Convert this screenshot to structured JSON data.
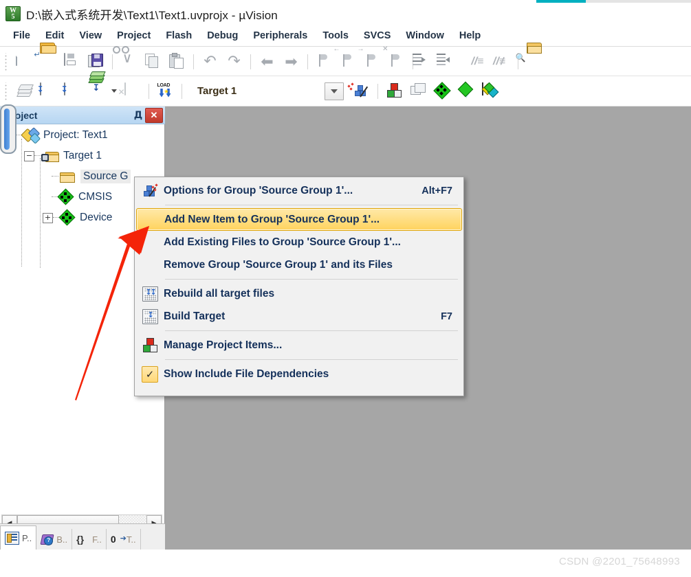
{
  "titlebar": {
    "title": "D:\\嵌入式系统开发\\Text1\\Text1.uvprojx - µVision",
    "app_icon": "keil-uvision-icon",
    "icon_text_top": "W",
    "icon_text_bottom": "5"
  },
  "menubar": {
    "items": [
      {
        "label": "File"
      },
      {
        "label": "Edit"
      },
      {
        "label": "View"
      },
      {
        "label": "Project"
      },
      {
        "label": "Flash"
      },
      {
        "label": "Debug"
      },
      {
        "label": "Peripherals"
      },
      {
        "label": "Tools"
      },
      {
        "label": "SVCS"
      },
      {
        "label": "Window"
      },
      {
        "label": "Help"
      }
    ]
  },
  "toolbar_file": {
    "buttons": [
      {
        "name": "new-file-button",
        "icon": "new-file-icon",
        "tooltip": "New"
      },
      {
        "name": "open-file-button",
        "icon": "open-folder-icon",
        "tooltip": "Open"
      },
      {
        "name": "save-button",
        "icon": "save-disk-icon",
        "tooltip": "Save"
      },
      {
        "name": "save-all-button",
        "icon": "save-all-icon",
        "tooltip": "Save All"
      },
      {
        "name": "cut-button",
        "icon": "scissors-icon",
        "tooltip": "Cut"
      },
      {
        "name": "copy-button",
        "icon": "copy-pages-icon",
        "tooltip": "Copy"
      },
      {
        "name": "paste-button",
        "icon": "clipboard-paste-icon",
        "tooltip": "Paste"
      },
      {
        "name": "undo-button",
        "icon": "undo-arrow-icon",
        "tooltip": "Undo"
      },
      {
        "name": "redo-button",
        "icon": "redo-arrow-icon",
        "tooltip": "Redo"
      },
      {
        "name": "navigate-back-button",
        "icon": "arrow-left-icon",
        "tooltip": "Back"
      },
      {
        "name": "navigate-forward-button",
        "icon": "arrow-right-icon",
        "tooltip": "Forward"
      },
      {
        "name": "insert-bookmark-button",
        "icon": "bookmark-flag-icon",
        "tooltip": "Insert/Remove Bookmark"
      },
      {
        "name": "prev-bookmark-button",
        "icon": "bookmark-prev-icon",
        "tooltip": "Previous Bookmark"
      },
      {
        "name": "next-bookmark-button",
        "icon": "bookmark-next-icon",
        "tooltip": "Next Bookmark"
      },
      {
        "name": "clear-bookmarks-button",
        "icon": "bookmark-clear-icon",
        "tooltip": "Clear All Bookmarks"
      },
      {
        "name": "indent-button",
        "icon": "indent-right-icon",
        "tooltip": "Indent"
      },
      {
        "name": "outdent-button",
        "icon": "indent-left-icon",
        "tooltip": "Outdent"
      },
      {
        "name": "comment-button",
        "icon": "comment-lines-icon",
        "tooltip": "Comment"
      },
      {
        "name": "uncomment-button",
        "icon": "uncomment-lines-icon",
        "tooltip": "Uncomment"
      },
      {
        "name": "find-in-files-button",
        "icon": "find-in-files-icon",
        "tooltip": "Find in Files"
      }
    ]
  },
  "toolbar_build": {
    "buttons": [
      {
        "name": "translate-button",
        "icon": "translate-layers-icon",
        "tooltip": "Translate"
      },
      {
        "name": "build-button",
        "icon": "build-target-icon",
        "tooltip": "Build"
      },
      {
        "name": "rebuild-button",
        "icon": "rebuild-all-icon",
        "tooltip": "Rebuild"
      },
      {
        "name": "batch-build-button",
        "icon": "batch-build-icon",
        "tooltip": "Batch Build"
      },
      {
        "name": "batch-build-dropdown",
        "icon": "chevron-down-icon",
        "tooltip": "Batch Build Options"
      },
      {
        "name": "stop-build-button",
        "icon": "stop-build-icon",
        "tooltip": "Stop Build"
      },
      {
        "name": "download-button",
        "icon": "load-download-icon",
        "tooltip": "Download"
      },
      {
        "name": "target-options-button",
        "icon": "magic-wand-icon",
        "tooltip": "Options for Target"
      },
      {
        "name": "manage-project-items-button",
        "icon": "manage-items-cubes-icon",
        "tooltip": "Manage Project Items"
      },
      {
        "name": "manage-windows-button",
        "icon": "windows-stack-icon",
        "tooltip": "Manage Windows"
      },
      {
        "name": "pack-installer-button",
        "icon": "green-diamond-icon",
        "tooltip": "Pack Installer"
      },
      {
        "name": "manage-run-time-button",
        "icon": "run-time-env-icon",
        "tooltip": "Manage Run-Time Environment"
      },
      {
        "name": "select-software-packs-button",
        "icon": "software-packs-icon",
        "tooltip": "Select Software Packs"
      }
    ],
    "target_value": "Target 1",
    "target_dropdown_icon": "chevron-down-icon"
  },
  "project_panel": {
    "title": "Project",
    "pin_icon": "pin-icon",
    "pin_glyph": "Д",
    "close_icon": "close-icon",
    "close_glyph": "✕",
    "tree": [
      {
        "label": "Project: Text1",
        "icon": "project-icon",
        "toggle": "−",
        "level": 0
      },
      {
        "label": "Target 1",
        "icon": "target-folder-icon",
        "toggle": "−",
        "level": 1
      },
      {
        "label": "Source G",
        "icon": "folder-icon",
        "toggle": "",
        "level": 2,
        "selected": true
      },
      {
        "label": "CMSIS",
        "icon": "green-diamond-icon",
        "toggle": "",
        "level": 2
      },
      {
        "label": "Device",
        "icon": "green-diamond-icon",
        "toggle": "+",
        "level": 2
      }
    ],
    "hscroll": {
      "left_arrow": "◀",
      "right_arrow": "▶"
    },
    "tabs": [
      {
        "label": "P..",
        "icon": "project-tab-icon",
        "active": true
      },
      {
        "label": "B..",
        "icon": "books-tab-icon",
        "active": false
      },
      {
        "label": "F..",
        "icon": "functions-tab-icon",
        "glyph": "{}",
        "active": false
      },
      {
        "label": "T..",
        "icon": "templates-tab-icon",
        "glyph": "0",
        "active": false
      }
    ]
  },
  "context_menu": {
    "items": [
      {
        "label": "Options for Group 'Source Group 1'...",
        "shortcut": "Alt+F7",
        "icon": "magic-wand-icon",
        "highlighted": false,
        "separator_after": true
      },
      {
        "label": "Add New  Item to Group 'Source Group 1'...",
        "shortcut": "",
        "icon": "",
        "highlighted": true,
        "separator_after": false
      },
      {
        "label": "Add Existing Files to Group 'Source Group 1'...",
        "shortcut": "",
        "icon": "",
        "highlighted": false,
        "separator_after": false
      },
      {
        "label": "Remove Group 'Source Group 1' and its Files",
        "shortcut": "",
        "icon": "",
        "highlighted": false,
        "separator_after": true
      },
      {
        "label": "Rebuild all target files",
        "shortcut": "",
        "icon": "rebuild-all-icon",
        "highlighted": false,
        "separator_after": false
      },
      {
        "label": "Build Target",
        "shortcut": "F7",
        "icon": "build-target-icon",
        "highlighted": false,
        "separator_after": true
      },
      {
        "label": "Manage Project Items...",
        "shortcut": "",
        "icon": "manage-items-cubes-icon",
        "highlighted": false,
        "separator_after": true
      },
      {
        "label": "Show Include File Dependencies",
        "shortcut": "",
        "icon": "checkbox-checked-icon",
        "checked": true,
        "check_glyph": "✓",
        "highlighted": false,
        "separator_after": false
      }
    ]
  },
  "annotation": {
    "arrow_color": "#f42409",
    "arrow_name": "red-pointer-arrow"
  },
  "watermark": {
    "text": "CSDN @2201_75648993"
  },
  "colors": {
    "accent_teal": "#00b0c0",
    "panel_header": "#b7d6f2",
    "workspace_bg": "#a6a6a6",
    "menu_highlight": "#ffd35e",
    "tree_text": "#17365d"
  }
}
